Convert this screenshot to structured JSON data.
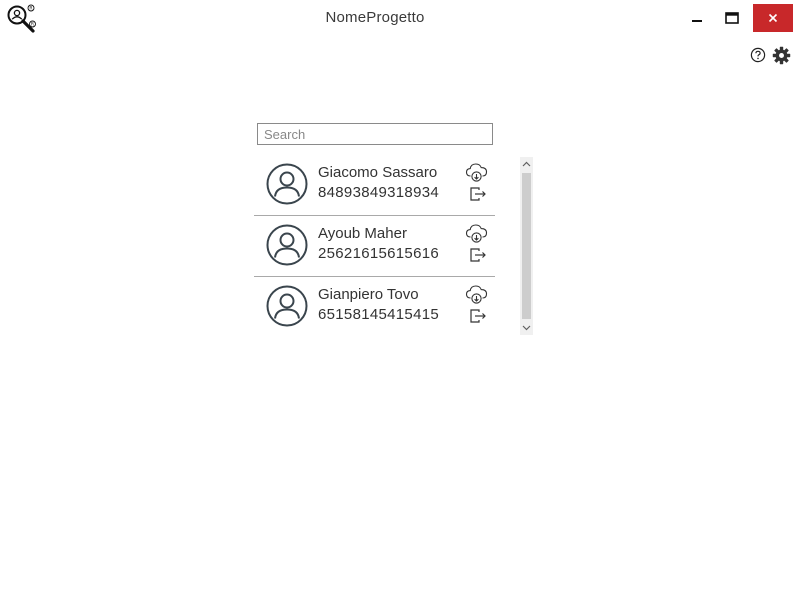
{
  "window": {
    "title": "NomeProgetto",
    "minimize_icon": "minimize-icon",
    "maximize_icon": "maximize-icon",
    "close_icon": "close-icon",
    "close_color": "#c8282a"
  },
  "toolbar": {
    "help_icon": "help-icon",
    "settings_icon": "gear-icon"
  },
  "search": {
    "placeholder": "Search",
    "value": ""
  },
  "users": [
    {
      "name": "Giacomo Sassaro",
      "id": "84893849318934"
    },
    {
      "name": "Ayoub Maher",
      "id": "25621615615616"
    },
    {
      "name": "Gianpiero Tovo",
      "id": "65158145415415"
    }
  ]
}
